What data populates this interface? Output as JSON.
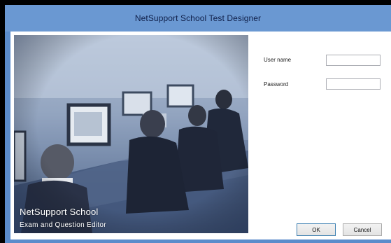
{
  "window": {
    "title": "NetSupport School Test Designer"
  },
  "branding": {
    "name": "NetSupport School",
    "subtitle": "Exam and Question Editor"
  },
  "login": {
    "username_label": "User name",
    "username_value": "",
    "password_label": "Password",
    "password_value": ""
  },
  "buttons": {
    "ok_label": "OK",
    "cancel_label": "Cancel"
  },
  "colors": {
    "titlebar": "#6a98d2",
    "frame": "#5b8ccb",
    "photo_tint": "#4e658b"
  }
}
